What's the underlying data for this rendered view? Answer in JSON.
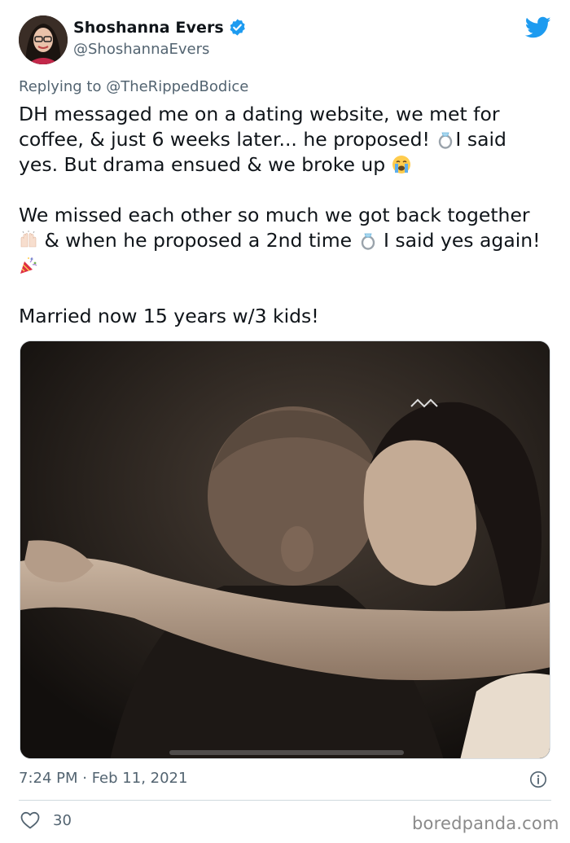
{
  "author": {
    "display_name": "Shoshanna Evers",
    "handle": "@ShoshannaEvers",
    "verified": true
  },
  "reply": {
    "prefix": "Replying to ",
    "target": "@TheRippedBodice"
  },
  "tweet": {
    "p1_a": "DH messaged me on a dating website, we met for coffee, & just 6 weeks later... he proposed! ",
    "p1_b": "I said yes. But drama ensued & we broke up ",
    "p2_a": "We missed each other so much we got back together ",
    "p2_b": " & when he proposed a 2nd time ",
    "p2_c": " I said yes again! ",
    "p3": "Married now 15 years w/3 kids!"
  },
  "icons": {
    "ring": "ring-emoji",
    "crying": "loudly-crying-face-emoji",
    "raised_hands": "raised-hands-emoji",
    "party": "party-popper-emoji",
    "bird": "twitter-bird-icon",
    "info": "info-icon",
    "heart": "heart-icon"
  },
  "meta": {
    "timestamp": "7:24 PM · Feb 11, 2021",
    "like_count": "30"
  },
  "watermark": "boredpanda.com",
  "colors": {
    "twitter_blue": "#1d9bf0",
    "secondary_text": "#536471"
  }
}
